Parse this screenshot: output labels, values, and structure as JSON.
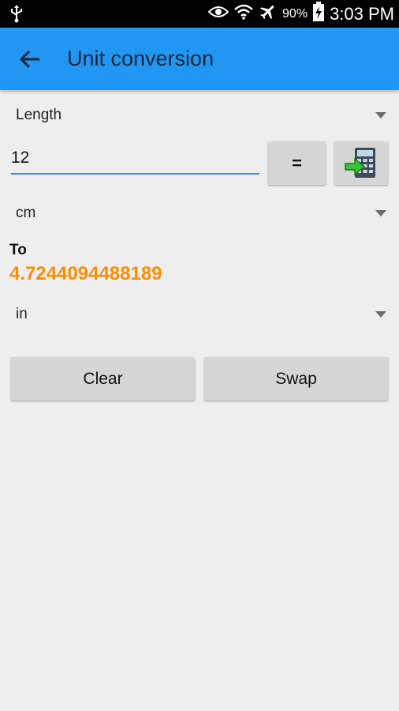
{
  "status_bar": {
    "battery": "90%",
    "time": "3:03 PM",
    "icons": [
      "usb-icon",
      "eye-icon",
      "wifi-icon",
      "airplane-icon",
      "battery-charging-icon"
    ]
  },
  "app_bar": {
    "title": "Unit conversion",
    "back_icon": "arrow-back-icon",
    "color": "#2196f3"
  },
  "category": {
    "selected": "Length"
  },
  "input": {
    "value": "12"
  },
  "equals_button": {
    "label": "="
  },
  "calculator_button": {
    "icon": "calculator-arrow-icon"
  },
  "from_unit": {
    "selected": "cm"
  },
  "result": {
    "label": "To",
    "value": "4.7244094488189",
    "color": "#ff8c00"
  },
  "to_unit": {
    "selected": "in"
  },
  "actions": {
    "clear_label": "Clear",
    "swap_label": "Swap"
  }
}
